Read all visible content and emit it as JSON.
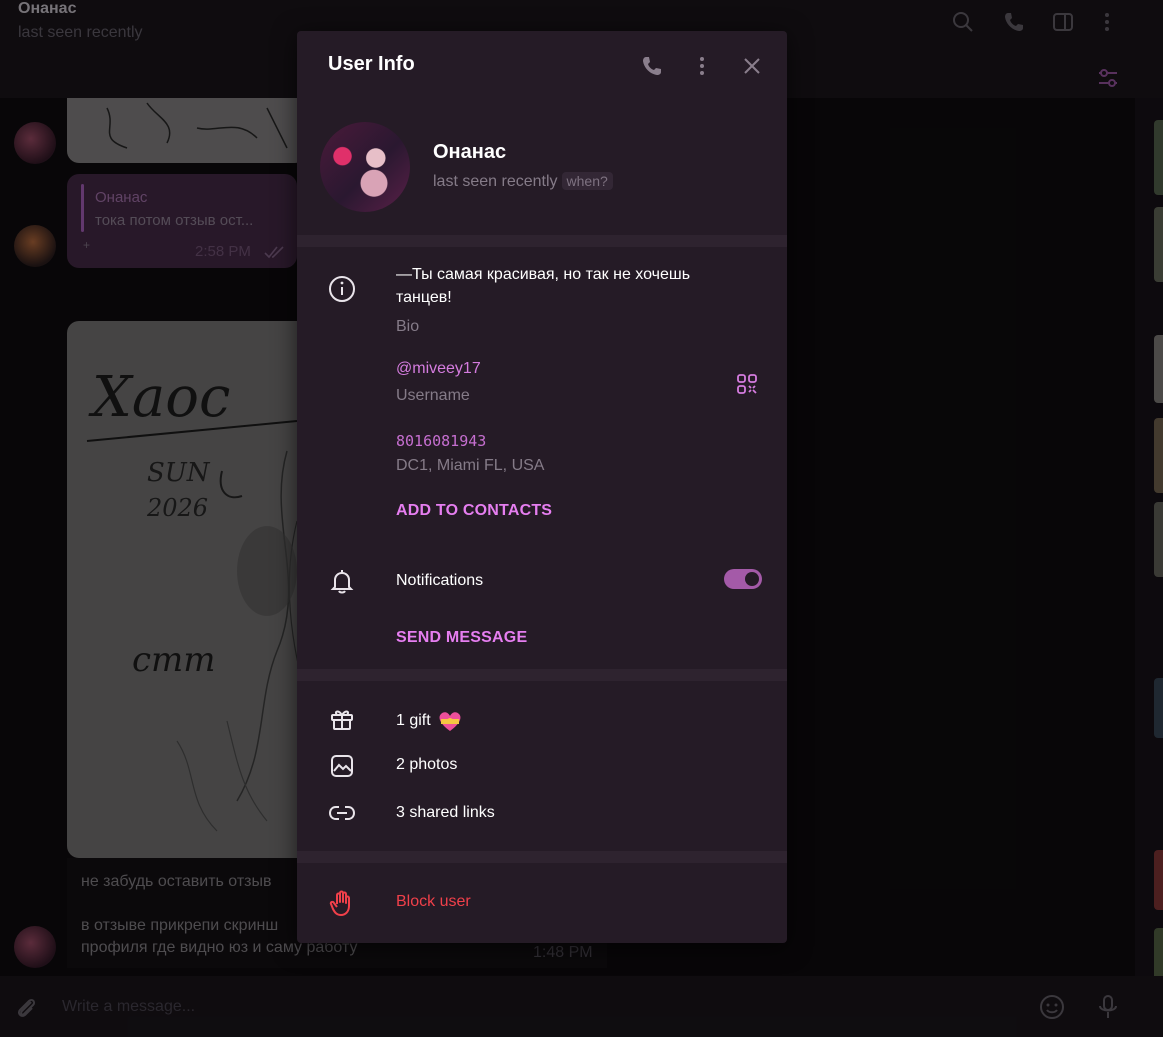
{
  "chat": {
    "title": "Онанас",
    "status": "last seen recently",
    "reply": {
      "name": "Онанас",
      "text": "тока потом отзыв ост...",
      "plus": "+",
      "time": "2:58 PM"
    },
    "caption_line1": "не забудь оставить отзыв",
    "caption_line2": "в отзыве прикрепи скринш",
    "caption_line3": "профиля где видно юз и саму работу",
    "caption_time": "1:48 PM",
    "sketch_text": [
      "Хаос",
      "SUN",
      "2026",
      "cmm"
    ],
    "composer_placeholder": "Write a message..."
  },
  "user_info": {
    "title": "User Info",
    "name": "Онанас",
    "status": "last seen recently",
    "when_label": "when?",
    "bio": "—Ты самая красивая, но так не хочешь танцев!",
    "bio_label": "Bio",
    "username": "@miveey17",
    "username_label": "Username",
    "phone": "8016081943",
    "location": "DC1, Miami FL, USA",
    "add_contacts": "ADD TO CONTACTS",
    "notifications_label": "Notifications",
    "notifications_on": true,
    "send_message": "SEND MESSAGE",
    "gifts": "1 gift",
    "photos": "2 photos",
    "links": "3 shared links",
    "block": "Block user"
  },
  "colors": {
    "accent": "#e67ef0",
    "danger": "#f0404a",
    "panel": "#251b26"
  },
  "icons": [
    "search-icon",
    "phone-icon",
    "sidebar-icon",
    "more-icon",
    "filter-icon",
    "close-icon",
    "info-icon",
    "qr-icon",
    "bell-icon",
    "gift-icon",
    "photo-icon",
    "link-icon",
    "hand-icon",
    "attach-icon",
    "emoji-icon",
    "mic-icon"
  ]
}
